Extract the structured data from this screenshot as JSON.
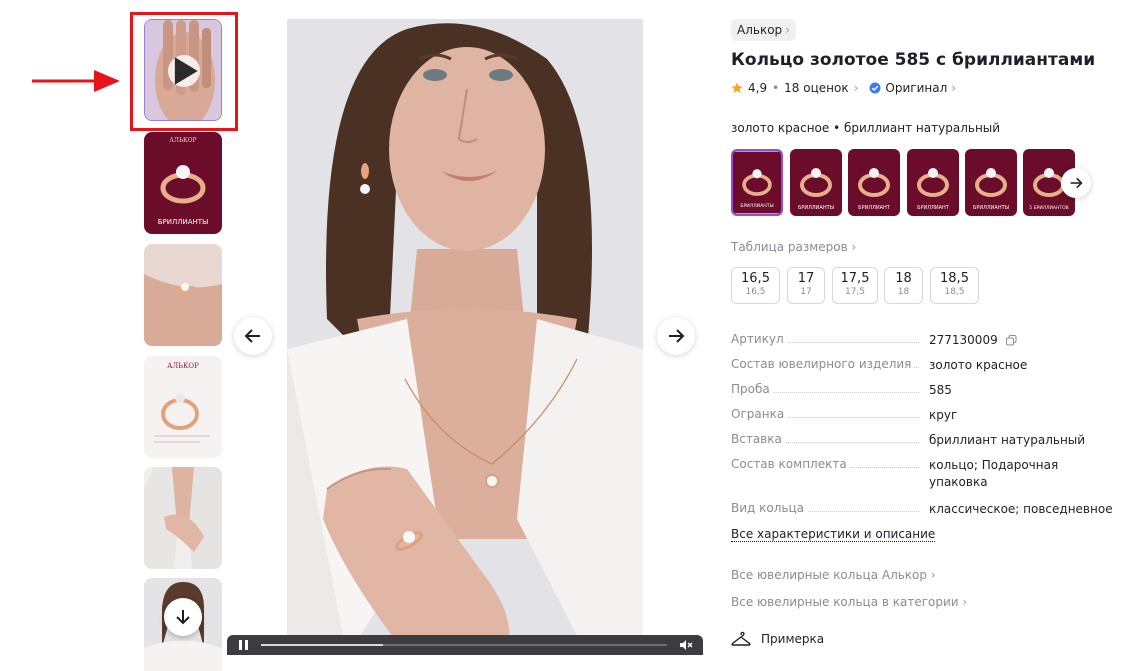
{
  "product": {
    "brand": "Алькор",
    "title": "Кольцо золотое 585 с бриллиантами",
    "rating": "4,9",
    "reviews": "18 оценок",
    "original_label": "Оригинал",
    "variant_label": "золото красное • бриллиант натуральный",
    "size_table_link": "Таблица размеров",
    "sizes": [
      {
        "main": "16,5",
        "sub": "16,5"
      },
      {
        "main": "17",
        "sub": "17"
      },
      {
        "main": "17,5",
        "sub": "17,5"
      },
      {
        "main": "18",
        "sub": "18"
      },
      {
        "main": "18,5",
        "sub": "18,5"
      }
    ],
    "specs": [
      {
        "key": "Артикул",
        "value": "277130009"
      },
      {
        "key": "Состав ювелирного изделия",
        "value": "золото красное"
      },
      {
        "key": "Проба",
        "value": "585"
      },
      {
        "key": "Огранка",
        "value": "круг"
      },
      {
        "key": "Вставка",
        "value": "бриллиант натуральный"
      },
      {
        "key": "Состав комплекта",
        "value": "кольцо; Подарочная упаковка"
      },
      {
        "key": "Вид кольца",
        "value": "классическое; повседневное"
      }
    ],
    "all_specs_link": "Все характеристики и описание",
    "brand_rings_link": "Все ювелирные кольца Алькор",
    "category_rings_link": "Все ювелирные кольца в категории",
    "try_on_label": "Примерка"
  },
  "gallery": {
    "thumb_brand_text": "АЛЬКОР",
    "thumb_promo_text": "БРИЛЛИАНТЫ",
    "variant_promo_texts": [
      "БРИЛЛИАНТЫ",
      "БРИЛЛИАНТЫ",
      "БРИЛЛИАНТ",
      "БРИЛЛИАНТ",
      "БРИЛЛИАНТЫ",
      "5 БРИЛЛИАНТОВ"
    ],
    "video_progress": 0.3
  },
  "colors": {
    "accent_purple": "#8f4fd6",
    "annotation_red": "#e8131b",
    "promo_burgundy": "#6b0d2a",
    "star": "#f5a623",
    "verified_blue": "#3d7bf2"
  },
  "icons": {
    "annotation": "red-arrow",
    "play": "play-icon",
    "prev": "arrow-left-icon",
    "next": "arrow-right-icon",
    "down": "arrow-down-icon",
    "star": "star-icon",
    "verified": "verified-badge-icon",
    "copy": "copy-icon",
    "tryon": "hanger-icon"
  }
}
